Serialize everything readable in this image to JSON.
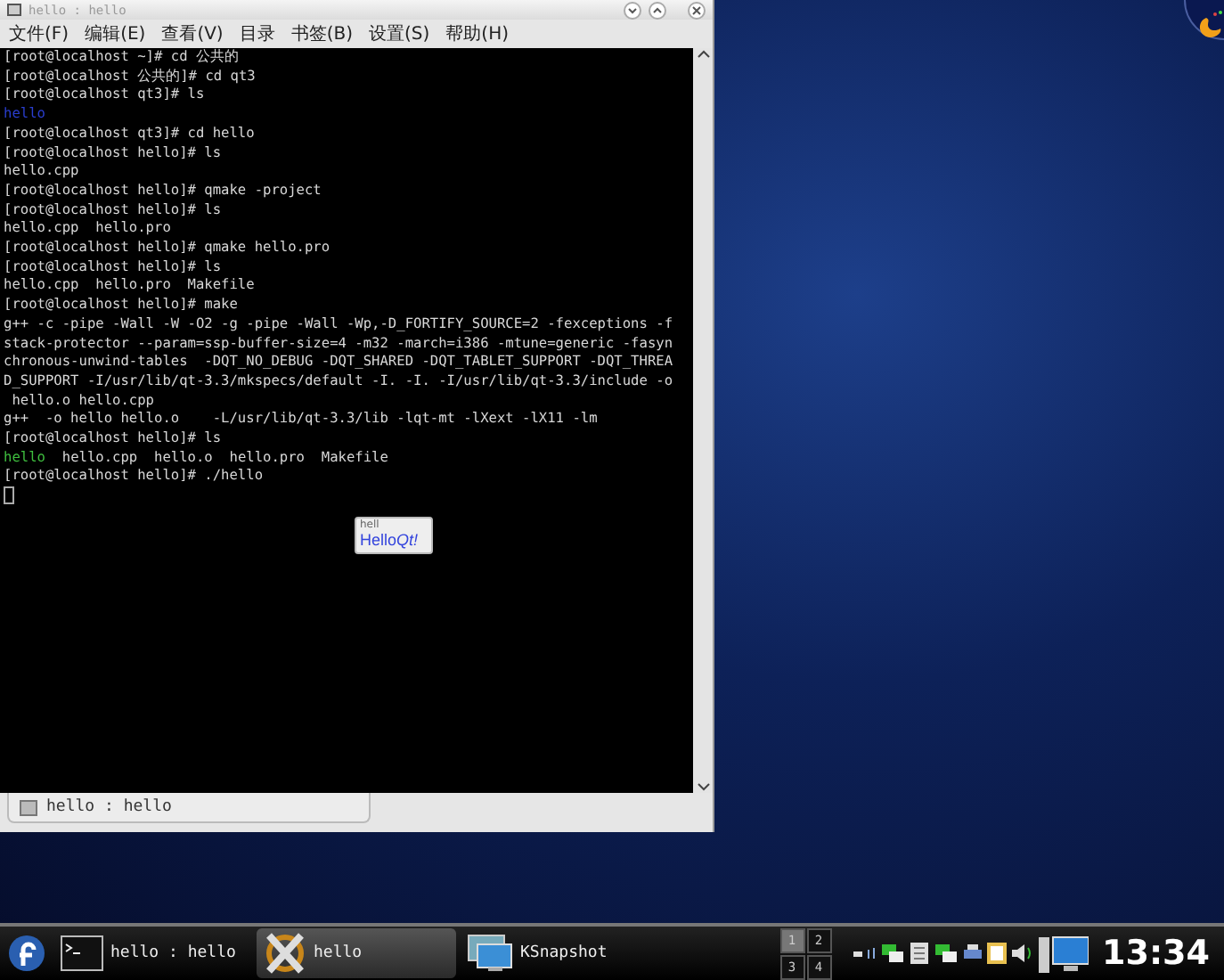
{
  "window": {
    "title": "hello : hello",
    "menu": [
      "文件(F)",
      "编辑(E)",
      "查看(V)",
      "目录",
      "书签(B)",
      "设置(S)",
      "帮助(H)"
    ]
  },
  "terminal": {
    "lines": [
      {
        "segments": [
          {
            "kind": "plain",
            "text": "[root@localhost ~]# cd 公共的"
          }
        ]
      },
      {
        "segments": [
          {
            "kind": "plain",
            "text": "[root@localhost 公共的]# cd qt3"
          }
        ]
      },
      {
        "segments": [
          {
            "kind": "plain",
            "text": "[root@localhost qt3]# ls"
          }
        ]
      },
      {
        "segments": [
          {
            "kind": "directory",
            "text": "hello"
          }
        ]
      },
      {
        "segments": [
          {
            "kind": "plain",
            "text": "[root@localhost qt3]# cd hello"
          }
        ]
      },
      {
        "segments": [
          {
            "kind": "plain",
            "text": "[root@localhost hello]# ls"
          }
        ]
      },
      {
        "segments": [
          {
            "kind": "plain",
            "text": "hello.cpp"
          }
        ]
      },
      {
        "segments": [
          {
            "kind": "plain",
            "text": "[root@localhost hello]# qmake -project"
          }
        ]
      },
      {
        "segments": [
          {
            "kind": "plain",
            "text": "[root@localhost hello]# ls"
          }
        ]
      },
      {
        "segments": [
          {
            "kind": "plain",
            "text": "hello.cpp  hello.pro"
          }
        ]
      },
      {
        "segments": [
          {
            "kind": "plain",
            "text": "[root@localhost hello]# qmake hello.pro"
          }
        ]
      },
      {
        "segments": [
          {
            "kind": "plain",
            "text": "[root@localhost hello]# ls"
          }
        ]
      },
      {
        "segments": [
          {
            "kind": "plain",
            "text": "hello.cpp  hello.pro  Makefile"
          }
        ]
      },
      {
        "segments": [
          {
            "kind": "plain",
            "text": "[root@localhost hello]# make"
          }
        ]
      },
      {
        "segments": [
          {
            "kind": "plain",
            "text": "g++ -c -pipe -Wall -W -O2 -g -pipe -Wall -Wp,-D_FORTIFY_SOURCE=2 -fexceptions -f"
          }
        ]
      },
      {
        "segments": [
          {
            "kind": "plain",
            "text": "stack-protector --param=ssp-buffer-size=4 -m32 -march=i386 -mtune=generic -fasyn"
          }
        ]
      },
      {
        "segments": [
          {
            "kind": "plain",
            "text": "chronous-unwind-tables  -DQT_NO_DEBUG -DQT_SHARED -DQT_TABLET_SUPPORT -DQT_THREA"
          }
        ]
      },
      {
        "segments": [
          {
            "kind": "plain",
            "text": "D_SUPPORT -I/usr/lib/qt-3.3/mkspecs/default -I. -I. -I/usr/lib/qt-3.3/include -o"
          }
        ]
      },
      {
        "segments": [
          {
            "kind": "plain",
            "text": " hello.o hello.cpp"
          }
        ]
      },
      {
        "segments": [
          {
            "kind": "plain",
            "text": "g++  -o hello hello.o    -L/usr/lib/qt-3.3/lib -lqt-mt -lXext -lX11 -lm"
          }
        ]
      },
      {
        "segments": [
          {
            "kind": "plain",
            "text": "[root@localhost hello]# ls"
          }
        ]
      },
      {
        "segments": [
          {
            "kind": "executable",
            "text": "hello"
          },
          {
            "kind": "plain",
            "text": "  hello.cpp  hello.o  hello.pro  Makefile"
          }
        ]
      },
      {
        "segments": [
          {
            "kind": "plain",
            "text": "[root@localhost hello]# ./hello"
          }
        ]
      }
    ]
  },
  "tabs": [
    {
      "label": "hello : hello",
      "selected": true
    }
  ],
  "qt_window": {
    "title": "hell",
    "label": [
      {
        "kind": "plain",
        "text": "Hello"
      },
      {
        "kind": "emphasis",
        "text": "Qt!"
      }
    ]
  },
  "taskbar": {
    "tasks": [
      {
        "kind": "terminal",
        "label": "hello : hello",
        "selected": false
      },
      {
        "kind": "qt",
        "label": "hello",
        "selected": true
      },
      {
        "kind": "snapshot",
        "label": "KSnapshot",
        "selected": false
      }
    ],
    "pager": [
      {
        "label": "1",
        "selected": true
      },
      {
        "label": "2",
        "selected": false
      },
      {
        "label": "3",
        "selected": false
      },
      {
        "label": "4",
        "selected": false
      }
    ],
    "clock": "13:34"
  }
}
